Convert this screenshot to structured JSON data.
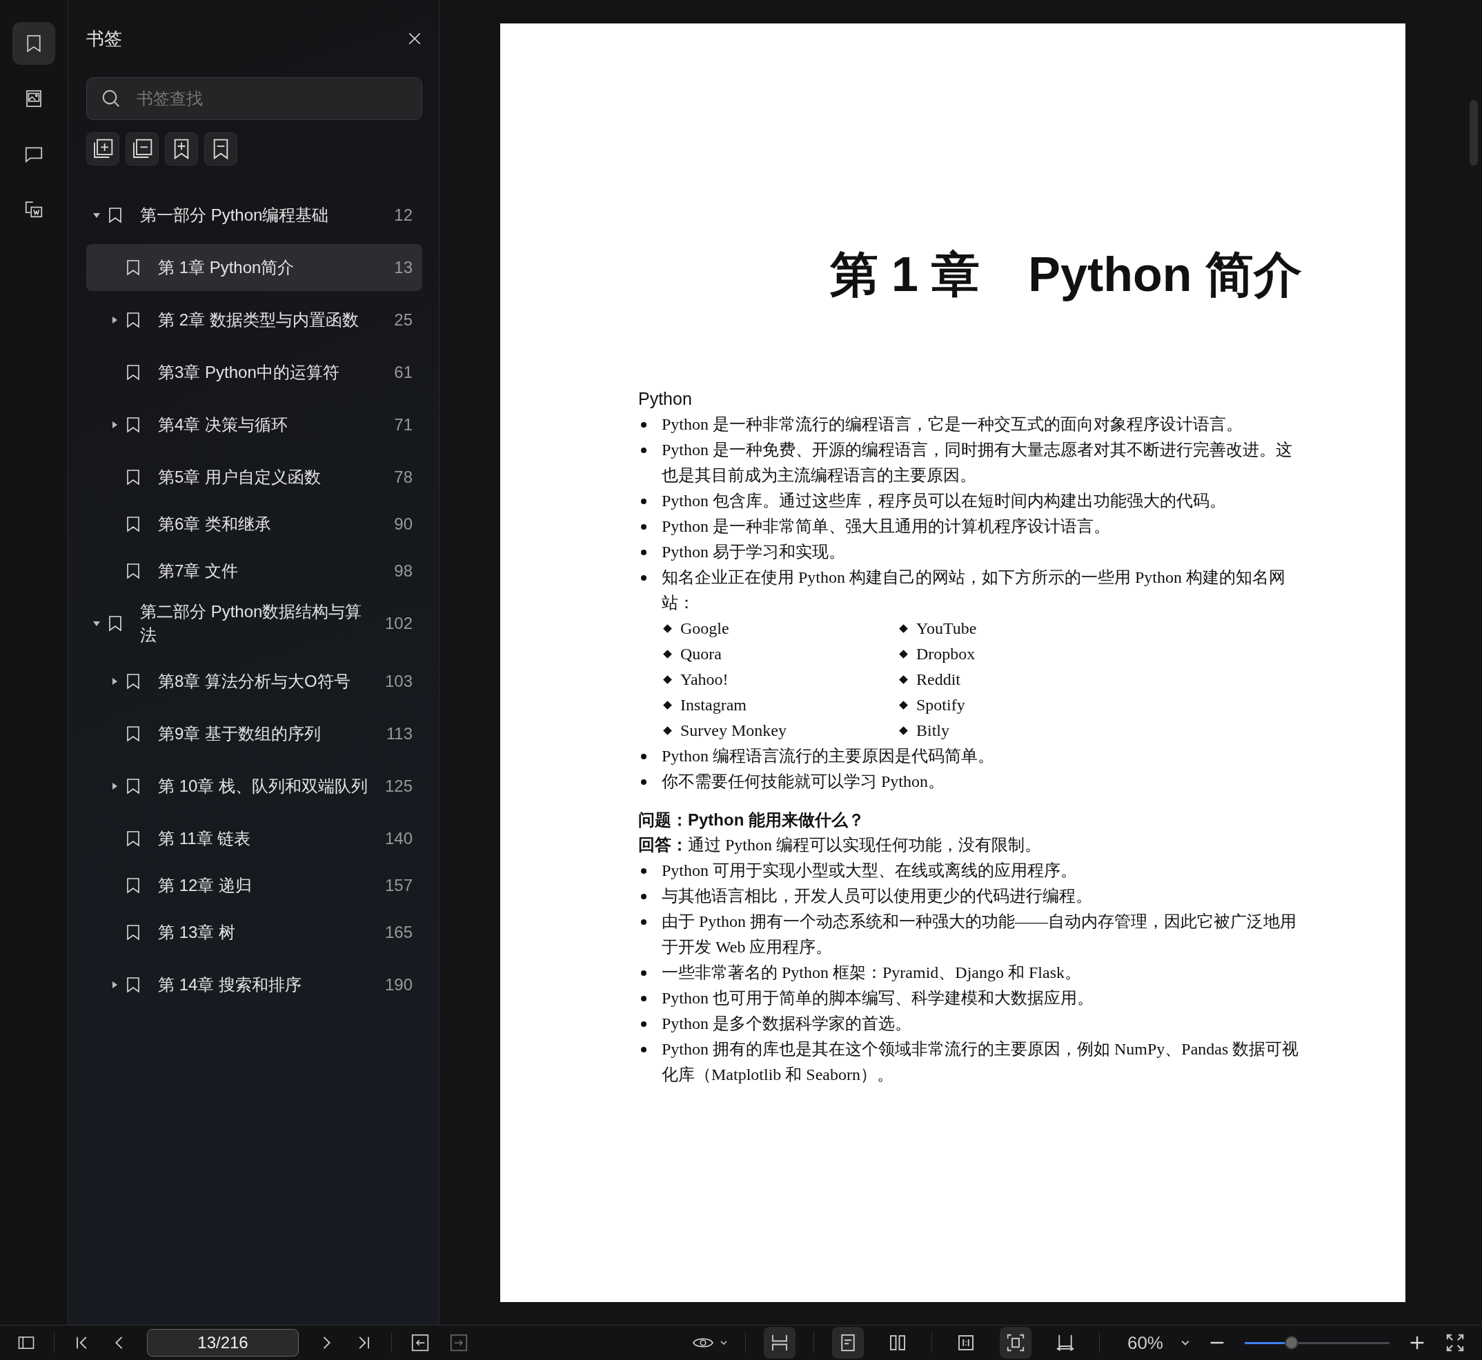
{
  "rail": [
    {
      "kind": "bookmarks",
      "selected": true
    },
    {
      "kind": "thumbnails",
      "selected": false
    },
    {
      "kind": "comments",
      "selected": false
    },
    {
      "kind": "convert",
      "selected": false
    }
  ],
  "sidebar": {
    "title": "书签",
    "search": {
      "placeholder": "书签查找"
    },
    "tree": [
      {
        "title": "第一部分 Python编程基础",
        "page": "12",
        "expanded": true,
        "selected": false,
        "children": [
          {
            "title": "第 1章 Python简介",
            "page": "13",
            "selected": true
          },
          {
            "title": "第 2章 数据类型与内置函数",
            "page": "25",
            "expanded": false,
            "selected": false
          },
          {
            "title": "第3章 Python中的运算符",
            "page": "61",
            "selected": false
          },
          {
            "title": "第4章 决策与循环",
            "page": "71",
            "expanded": false,
            "selected": false
          },
          {
            "title": "第5章 用户自定义函数",
            "page": "78",
            "selected": false
          },
          {
            "title": "第6章 类和继承",
            "page": "90",
            "selected": false
          },
          {
            "title": "第7章 文件",
            "page": "98",
            "selected": false
          }
        ]
      },
      {
        "title": "第二部分 Python数据结构与算法",
        "page": "102",
        "expanded": true,
        "selected": false,
        "children": [
          {
            "title": "第8章 算法分析与大O符号",
            "page": "103",
            "expanded": false,
            "selected": false
          },
          {
            "title": "第9章 基于数组的序列",
            "page": "113",
            "selected": false
          },
          {
            "title": "第 10章 栈、队列和双端队列",
            "page": "125",
            "expanded": false,
            "selected": false
          },
          {
            "title": "第 11章 链表",
            "page": "140",
            "selected": false
          },
          {
            "title": "第 12章 递归",
            "page": "157",
            "selected": false
          },
          {
            "title": "第 13章 树",
            "page": "165",
            "selected": false
          },
          {
            "title": "第 14章 搜索和排序",
            "page": "190",
            "expanded": false,
            "selected": false
          }
        ]
      }
    ]
  },
  "document": {
    "heading": "第 1 章　Python 简介",
    "blocks": [
      {
        "kind": "subhead",
        "text": "Python"
      },
      {
        "kind": "bullet",
        "text": "Python 是一种非常流行的编程语言，它是一种交互式的面向对象程序设计语言。"
      },
      {
        "kind": "bullet",
        "text": "Python 是一种免费、开源的编程语言，同时拥有大量志愿者对其不断进行完善改进。这也是其目前成为主流编程语言的主要原因。"
      },
      {
        "kind": "bullet",
        "text": "Python 包含库。通过这些库，程序员可以在短时间内构建出功能强大的代码。"
      },
      {
        "kind": "bullet",
        "text": "Python 是一种非常简单、强大且通用的计算机程序设计语言。"
      },
      {
        "kind": "bullet",
        "text": "Python 易于学习和实现。"
      },
      {
        "kind": "bullet",
        "text": "知名企业正在使用 Python 构建自己的网站，如下方所示的一些用 Python 构建的知名网站："
      },
      {
        "kind": "columns",
        "items": [
          "Google",
          "YouTube",
          "Quora",
          "Dropbox",
          "Yahoo!",
          "Reddit",
          "Instagram",
          "Spotify",
          "Survey Monkey",
          "Bitly"
        ]
      },
      {
        "kind": "bullet",
        "text": "Python 编程语言流行的主要原因是代码简单。"
      },
      {
        "kind": "bullet",
        "text": "你不需要任何技能就可以学习 Python。"
      },
      {
        "kind": "question",
        "text": "问题：Python 能用来做什么？"
      },
      {
        "kind": "plain",
        "text": "**回答：**通过 Python 编程可以实现任何功能，没有限制。"
      },
      {
        "kind": "bullet",
        "text": "Python 可用于实现小型或大型、在线或离线的应用程序。"
      },
      {
        "kind": "bullet",
        "text": "与其他语言相比，开发人员可以使用更少的代码进行编程。"
      },
      {
        "kind": "bullet",
        "text": "由于 Python 拥有一个动态系统和一种强大的功能——自动内存管理，因此它被广泛地用于开发 Web 应用程序。"
      },
      {
        "kind": "bullet",
        "text": "一些非常著名的 Python 框架：Pyramid、Django 和 Flask。"
      },
      {
        "kind": "bullet",
        "text": "Python 也可用于简单的脚本编写、科学建模和大数据应用。"
      },
      {
        "kind": "bullet",
        "text": "Python 是多个数据科学家的首选。"
      },
      {
        "kind": "bullet",
        "text": "Python 拥有的库也是其在这个领域非常流行的主要原因，例如 NumPy、Pandas 数据可视化库（Matplotlib 和 Seaborn）。"
      }
    ]
  },
  "toolbar": {
    "page": "13/216",
    "forward_disabled": true,
    "views": [
      {
        "kind": "scroll",
        "selected": true
      },
      {
        "kind": "single",
        "selected": true
      },
      {
        "kind": "double",
        "selected": false
      },
      {
        "kind": "actual",
        "selected": false
      },
      {
        "kind": "fit-page",
        "selected": true
      },
      {
        "kind": "fit-width",
        "selected": false
      }
    ],
    "zoom": "60%",
    "zoom_slider": {
      "level": 0.33
    }
  }
}
